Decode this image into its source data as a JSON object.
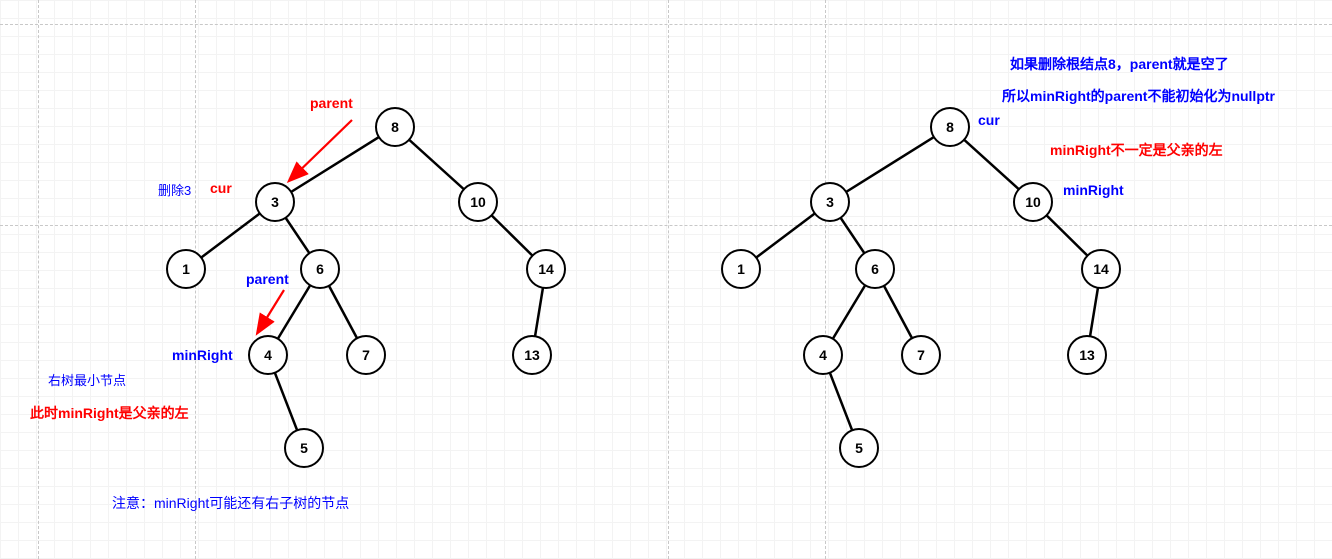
{
  "tree": {
    "nodes": {
      "n8": "8",
      "n3": "3",
      "n10": "10",
      "n1": "1",
      "n6": "6",
      "n14": "14",
      "n4": "4",
      "n7": "7",
      "n13": "13",
      "n5": "5"
    }
  },
  "left": {
    "annotations": {
      "parent_top": "parent",
      "cur": "cur",
      "delete3": "删除3",
      "parent_mid": "parent",
      "minRight": "minRight",
      "rightTreeMin": "右树最小节点",
      "isLeft": "此时minRight是父亲的左",
      "note": "注意：minRight可能还有右子树的节点"
    }
  },
  "right": {
    "annotations": {
      "cur": "cur",
      "minRight": "minRight",
      "line1": "如果删除根结点8，parent就是空了",
      "line2": "所以minRight的parent不能初始化为nullptr",
      "line3": "minRight不一定是父亲的左"
    }
  }
}
